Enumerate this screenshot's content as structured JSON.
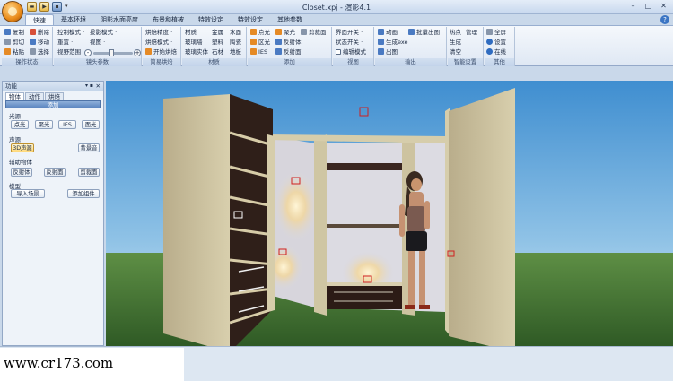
{
  "window": {
    "title": "Closet.xpj - 渲影4.1",
    "minimize": "–",
    "maximize": "□",
    "close": "✕"
  },
  "qat": {
    "more": "▾"
  },
  "tabs": [
    {
      "label": "快速"
    },
    {
      "label": "基本环境"
    },
    {
      "label": "阴影水面亮度"
    },
    {
      "label": "布景和植被"
    },
    {
      "label": "特效设定"
    },
    {
      "label": "特效设定"
    },
    {
      "label": "其他参数"
    }
  ],
  "help": "?",
  "ribbon": {
    "ops": {
      "caption": "操作状态",
      "copy": "复制",
      "delete": "删除",
      "cut": "剪切",
      "move": "移动",
      "paste": "粘贴",
      "select": "选择"
    },
    "camera": {
      "caption": "镜头参数",
      "control_mode": "控制模式 ·",
      "projection_mode": "投影模式 ·",
      "reset": "重置 ·",
      "view": "视图 ·",
      "view_range": "视野范围"
    },
    "bake": {
      "caption": "简易烘焙",
      "bake_precision": "烘焙精度 ·",
      "bake_mode": "烘焙模式 ·",
      "start_bake": "开始烘焙"
    },
    "material": {
      "caption": "材质",
      "mat": "材质",
      "metal": "金属",
      "water": "水面",
      "glass_wall": "玻璃墙",
      "plastic": "塑料",
      "ceramic": "陶瓷",
      "glass_solid": "玻璃实体",
      "stone": "石材",
      "floor": "地板"
    },
    "add": {
      "caption": "添加",
      "point_light": "点光",
      "spot_light": "聚光",
      "clip_plane": "剪裁面",
      "area_light": "区光",
      "reflector": "反射体",
      "ies": "IES",
      "reflect_plane": "反射面"
    },
    "view": {
      "caption": "视图",
      "ui_switch": "界面开关 ·",
      "state_switch": "状态开关 ·",
      "edit_mode": "编辑模式"
    },
    "output": {
      "caption": "输出",
      "animation": "动画",
      "batch_output": "批量出图",
      "gen_exe": "生成exe",
      "render_out": "出图"
    },
    "smart": {
      "caption": "智能设置",
      "hotspot": "热点",
      "manage": "管理",
      "generate": "生成",
      "clear": "清空"
    },
    "other": {
      "caption": "其他",
      "fullscreen": "全屏",
      "settings": "设置",
      "online": "在线"
    }
  },
  "panel": {
    "title": "功能",
    "pin": "▾ ▪",
    "close": "✕",
    "tabs": [
      "物体",
      "动作",
      "烘焙"
    ],
    "add": "添加",
    "light_source": "光源",
    "point_light": "点光",
    "spot_light": "聚光",
    "ies": "IES",
    "area_light": "面光",
    "sound_source": "声源",
    "sound_3d": "3D声源",
    "bg_sound": "背景音",
    "aux_objects": "辅助物体",
    "reflector": "反射体",
    "reflect_plane": "反射面",
    "clip_plane": "剪裁面",
    "model": "模型",
    "import_scene": "导入场景",
    "add_component": "添加组件"
  },
  "watermark": "www.cr173.com"
}
